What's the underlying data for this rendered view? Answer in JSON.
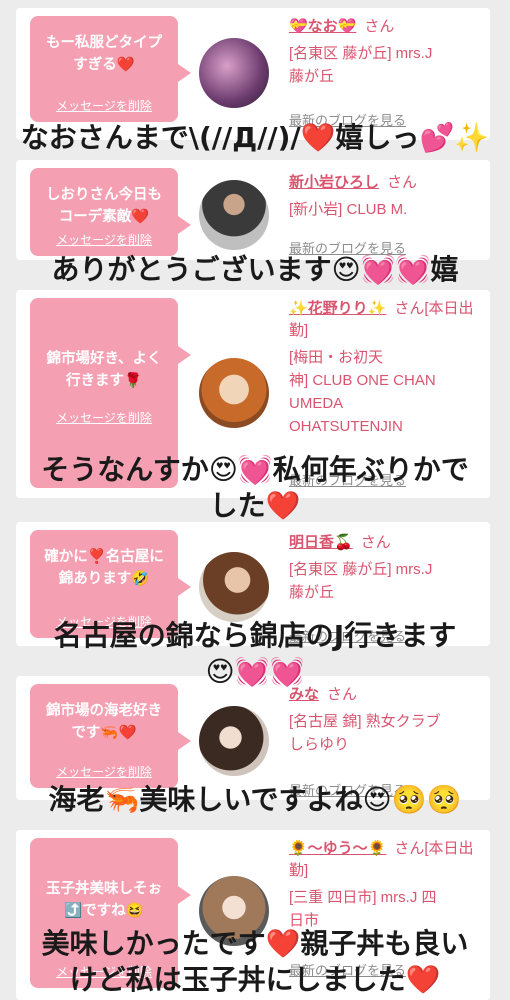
{
  "common": {
    "delete_label": "メッセージを削除",
    "blog_label": "最新のブログを見る",
    "san": "さん"
  },
  "cards": [
    {
      "message": "もー私服どタイプ\nすぎる❤️",
      "name": "💝なお💝",
      "san_extra": "",
      "shop": "[名東区 藤が丘] mrs.J\n藤が丘"
    },
    {
      "message": "しおりさん今日も\nコーデ素敵❤️",
      "name": "新小岩ひろし",
      "san_extra": "",
      "shop": "[新小岩] CLUB M."
    },
    {
      "message": "錦市場好き、よく\n行きます🌹",
      "name": "✨花野りり✨",
      "san_extra": "[本日出勤]",
      "shop": "[梅田・お初天\n神] CLUB ONE CHAN\nUMEDA\nOHATSUTENJIN"
    },
    {
      "message": "確かに❣️名古屋に\n錦あります🤣",
      "name": "明日香🍒",
      "san_extra": "",
      "shop": "[名東区 藤が丘] mrs.J\n藤が丘"
    },
    {
      "message": "錦市場の海老好き\nです🦐❤️",
      "name": "みな",
      "san_extra": "",
      "shop": "[名古屋 錦] 熟女クラブ\nしらゆり"
    },
    {
      "message": "玉子丼美味しそぉ\n⤴️ですね😆",
      "name": "🌻〜ゆう〜🌻",
      "san_extra": "[本日出勤]",
      "shop": "[三重 四日市] mrs.J 四\n日市"
    }
  ],
  "overlays": [
    "なおさんまで\\(//Д//)/❤️嬉しっ💕✨",
    "ありがとうございます😍💓💓嬉",
    "そうなんすか😍💓私何年ぶりかで\nした❤️",
    "名古屋の錦なら錦店のJ行きます\n😍💓💓",
    "海老🦐美味しいですよね😍🥺🥺",
    "美味しかったです❤️親子丼も良い\nけど私は玉子丼にしました❤️"
  ]
}
